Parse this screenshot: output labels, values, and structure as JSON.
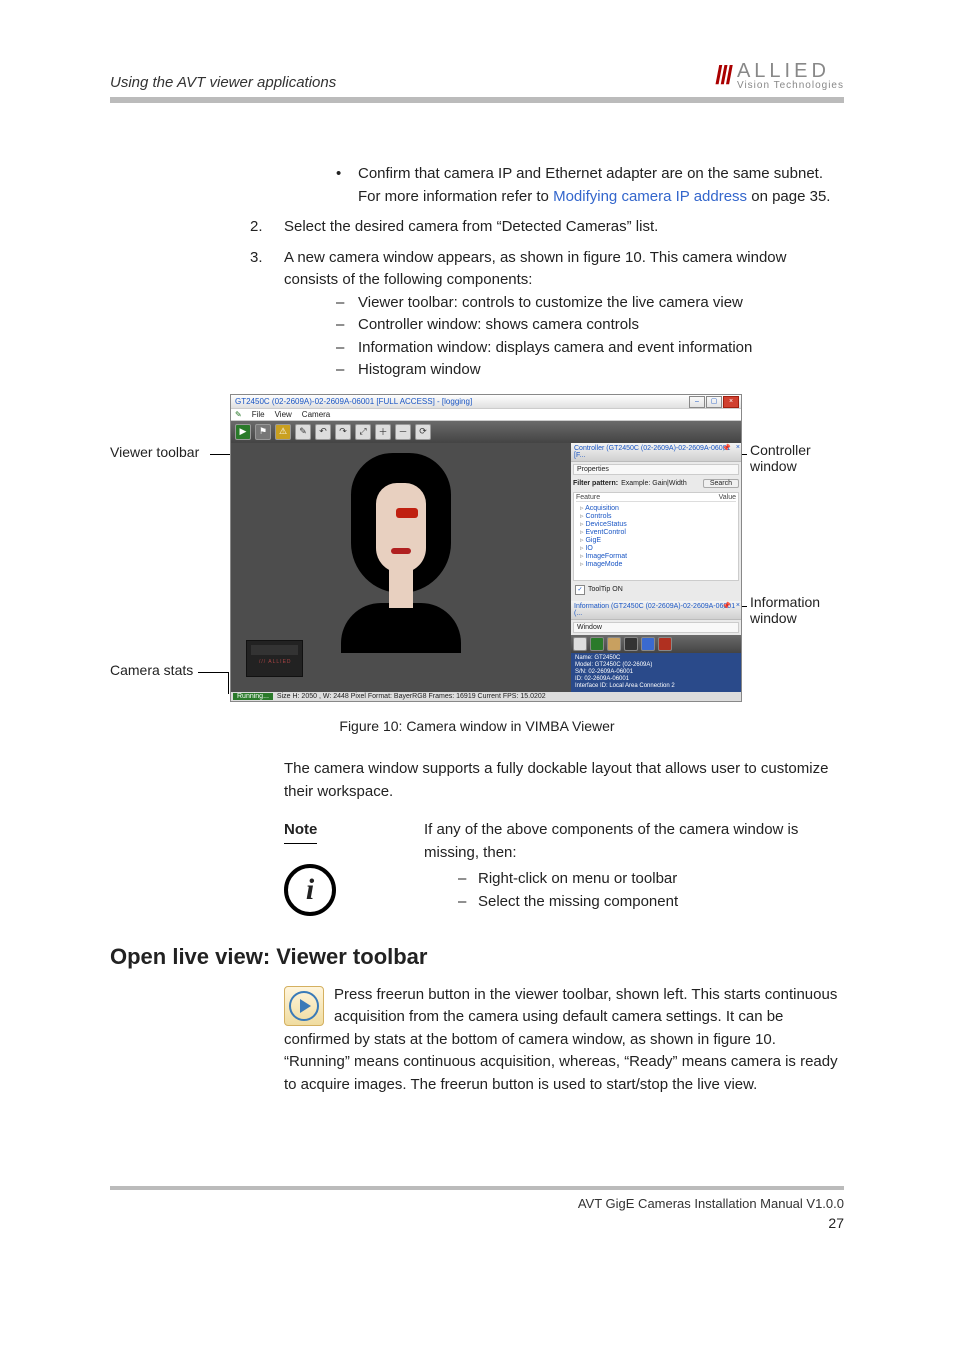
{
  "header": {
    "section_title": "Using the AVT viewer applications",
    "logo_big": "ALLIED",
    "logo_small": "Vision Technologies"
  },
  "bullets": {
    "bullet1": "Confirm that camera IP and Ethernet adapter are on the same subnet. For more information refer to ",
    "link1": "Modifying camera IP address",
    "link1_after": " on page 35.",
    "step2": "Select the desired camera from “Detected Cameras” list.",
    "step3": "A new camera window appears, as shown in figure 10. This camera window consists of the following components:",
    "dash1": "Viewer toolbar: controls to customize the live camera view",
    "dash2": "Controller window: shows camera controls",
    "dash3": "Information window: displays camera and event information",
    "dash4": "Histogram window"
  },
  "annot": {
    "viewer_toolbar": "Viewer toolbar",
    "camera_stats": "Camera stats",
    "controller_window_l1": "Controller",
    "controller_window_l2": "window",
    "info_window_l1": "Information",
    "info_window_l2": "window"
  },
  "vimba": {
    "title": "GT2450C (02-2609A)-02-2609A-06001 [FULL ACCESS] - [logging]",
    "menu_file": "File",
    "menu_view": "View",
    "menu_camera": "Camera",
    "controller_title": "Controller  (GT2450C (02-2609A)-02-2609A-06001 [F...",
    "properties": "Properties",
    "filter_lbl": "Filter pattern:",
    "filter_ex": "Example: Gain|Width",
    "search_btn": "Search",
    "th_feature": "Feature",
    "th_value": "Value",
    "tree_items": [
      "Acquisition",
      "Controls",
      "DeviceStatus",
      "EventControl",
      "GigE",
      "IO",
      "ImageFormat",
      "ImageMode"
    ],
    "tooltip_on": "ToolTip ON",
    "info_title": "Information (GT2450C (02-2609A)-02-2609A-06001 (...",
    "info_window_lbl": "Window",
    "info1": "Name: GT2450C",
    "info2": "Model: GT2450C (02-2609A)",
    "info3": "S/N: 02-2609A-06001",
    "info4": "ID: 02-2609A-06001",
    "info5": "Interface ID: Local Area Connection 2",
    "status_running": "Running...",
    "status_rest": "Size H: 2050 , W: 2448   Pixel Format: BayerRG8   Frames: 16919    Current FPS: 15.0202",
    "allied_label": "/// ALLIED"
  },
  "caption": "Figure 10: Camera window in VIMBA Viewer",
  "para1": "The camera window supports a fully dockable layout that allows user to customize their workspace.",
  "note": {
    "label": "Note",
    "text": "If any of the above components of the camera window is missing, then:",
    "item1": "Right-click on menu or toolbar",
    "item2": "Select the missing component"
  },
  "h2": "Open live view: Viewer toolbar",
  "live_para": "Press freerun button in the viewer toolbar, shown left. This starts continuous acquisition from the camera using default camera settings. It can be confirmed by stats at the bottom of camera window, as shown in figure 10. “Running” means continuous acquisition, whereas, “Ready” means camera is ready to acquire images. The freerun button is used to start/stop the live view.",
  "footer": {
    "doc_title": "AVT GigE Cameras Installation Manual V1.0.0",
    "page": "27"
  }
}
